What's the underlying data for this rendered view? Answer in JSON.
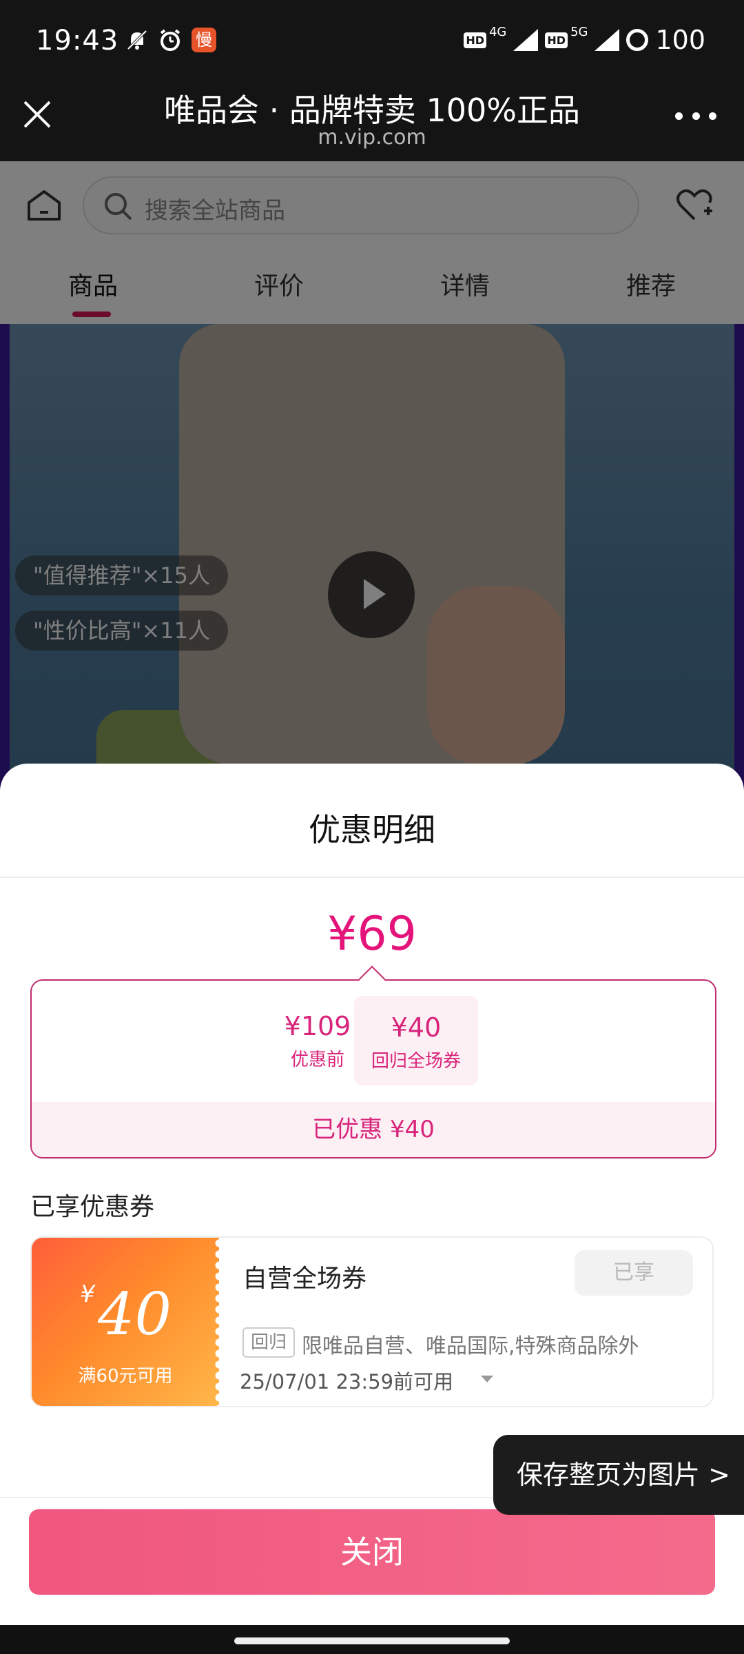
{
  "status_bar": {
    "time": "19:43",
    "app_icon_text": "慢",
    "battery": "100",
    "net1": "4G",
    "net2": "5G",
    "hd_label": "HD"
  },
  "browser": {
    "title": "唯品会 · 品牌特卖 100%正品",
    "url": "m.vip.com"
  },
  "search": {
    "placeholder": "搜索全站商品"
  },
  "tabs": [
    {
      "label": "商品",
      "active": true
    },
    {
      "label": "评价",
      "active": false
    },
    {
      "label": "详情",
      "active": false
    },
    {
      "label": "推荐",
      "active": false
    }
  ],
  "product_tags": [
    "\"值得推荐\"×15人",
    "\"性价比高\"×11人"
  ],
  "sheet": {
    "title": "优惠明细",
    "final_price": "¥69",
    "original_price": "¥109",
    "original_label": "优惠前",
    "minus": "-",
    "coupon_value": "¥40",
    "coupon_label": "回归全场券",
    "saved_text": "已优惠 ¥40",
    "coupons_heading": "已享优惠券",
    "coupon": {
      "yen": "¥",
      "amount": "40",
      "condition": "满60元可用",
      "name": "自营全场券",
      "status": "已享",
      "tag": "回归",
      "description": "限唯品自营、唯品国际,特殊商品除外",
      "validity": "25/07/01 23:59前可用"
    },
    "close_label": "关闭"
  },
  "toast": "保存整页为图片 >",
  "colors": {
    "accent": "#e4147a",
    "button": "#f0577f",
    "coupon_gradient_start": "#ff5e3a",
    "coupon_gradient_end": "#ffb74a"
  }
}
